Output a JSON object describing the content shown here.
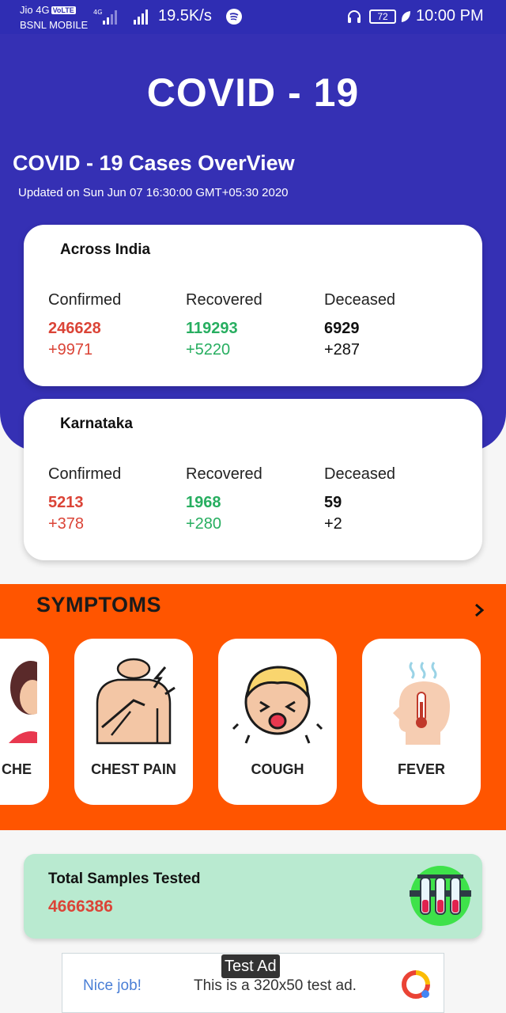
{
  "status_bar": {
    "carrier1": "Jio 4G",
    "volte": "VoLTE",
    "carrier2": "BSNL MOBILE",
    "speed": "19.5K/s",
    "battery": "72",
    "time": "10:00 PM"
  },
  "header": {
    "title": "COVID - 19",
    "overview_title": "COVID - 19 Cases OverView",
    "updated": "Updated on Sun Jun 07 16:30:00 GMT+05:30 2020"
  },
  "cards": [
    {
      "region": "Across India",
      "confirmed": {
        "label": "Confirmed",
        "count": "246628",
        "delta": "+9971"
      },
      "recovered": {
        "label": "Recovered",
        "count": "119293",
        "delta": "+5220"
      },
      "deceased": {
        "label": "Deceased",
        "count": "6929",
        "delta": "+287"
      }
    },
    {
      "region": "Karnataka",
      "confirmed": {
        "label": "Confirmed",
        "count": "5213",
        "delta": "+378"
      },
      "recovered": {
        "label": "Recovered",
        "count": "1968",
        "delta": "+280"
      },
      "deceased": {
        "label": "Deceased",
        "count": "59",
        "delta": "+2"
      }
    }
  ],
  "symptoms": {
    "title": "SYMPTOMS",
    "items": [
      {
        "label": "CHE",
        "icon": "headache-icon"
      },
      {
        "label": "CHEST PAIN",
        "icon": "chest-pain-icon"
      },
      {
        "label": "COUGH",
        "icon": "cough-icon"
      },
      {
        "label": "FEVER",
        "icon": "fever-icon"
      }
    ]
  },
  "tested": {
    "label": "Total Samples Tested",
    "value": "4666386"
  },
  "ad": {
    "badge": "Test Ad",
    "nice": "Nice job!",
    "text": "This is a 320x50 test ad."
  },
  "colors": {
    "primary": "#3530b4",
    "symptoms_band": "#ff5500",
    "confirmed": "#db4437",
    "recovered": "#27ae60",
    "tested_bg": "#b9ead0"
  }
}
